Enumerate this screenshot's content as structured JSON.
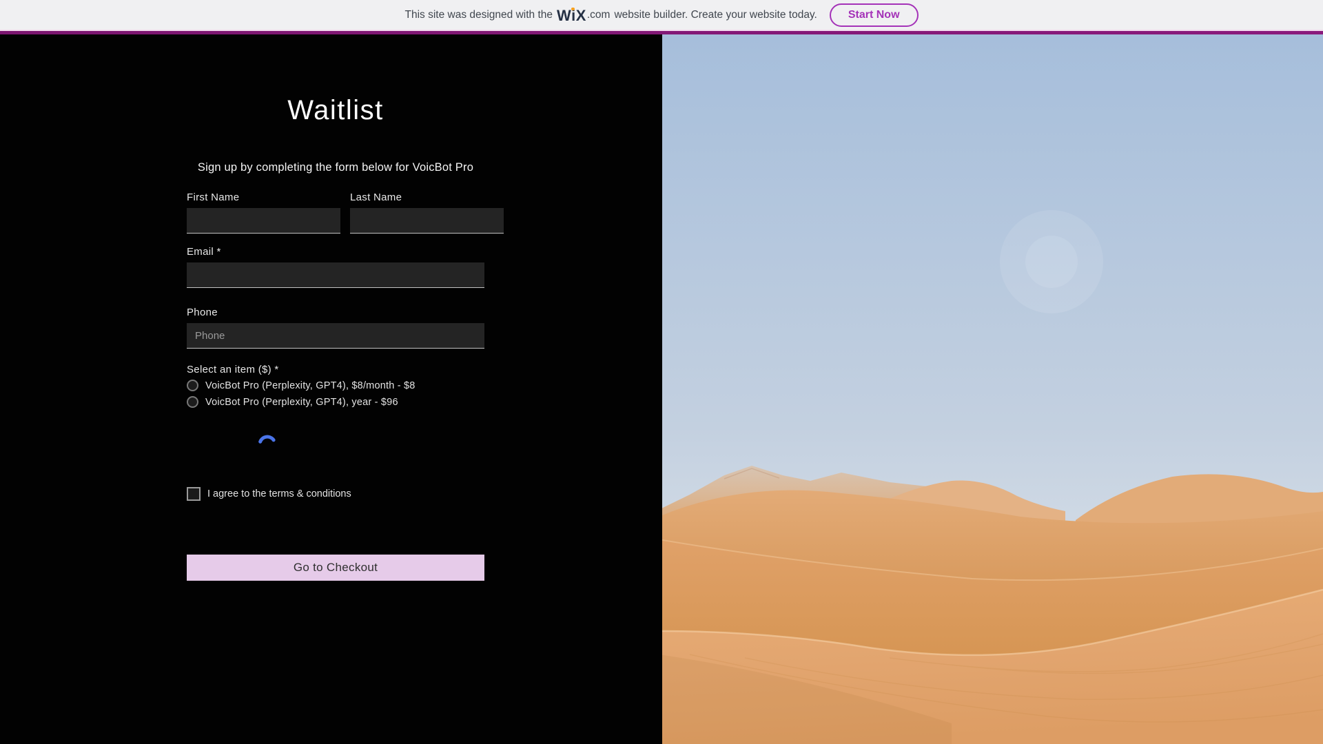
{
  "banner": {
    "message_prefix": "This site was designed with the",
    "wix_logo": "WiX",
    "wix_suffix": ".com",
    "message_mid": "website builder. Create your website today.",
    "start_button": "Start Now"
  },
  "form": {
    "title": "Waitlist",
    "subtitle": "Sign up by completing the form below for VoicBot Pro",
    "fields": {
      "first_name": {
        "label": "First Name",
        "value": "",
        "placeholder": ""
      },
      "last_name": {
        "label": "Last Name",
        "value": "",
        "placeholder": ""
      },
      "email": {
        "label": "Email *",
        "value": "",
        "placeholder": ""
      },
      "phone": {
        "label": "Phone",
        "value": "",
        "placeholder": "Phone"
      }
    },
    "select_item": {
      "label": "Select an item ($) *",
      "options": [
        {
          "label": "VoicBot Pro (Perplexity, GPT4), $8/month - $8",
          "selected": false
        },
        {
          "label": "VoicBot Pro (Perplexity, GPT4), year - $96",
          "selected": false
        }
      ]
    },
    "terms_checkbox": {
      "label": "I agree to the terms & conditions",
      "checked": false
    },
    "submit_button": "Go to Checkout",
    "status": "loading"
  },
  "colors": {
    "banner_accent": "#a432b8",
    "separator_stripe": "#7c1670",
    "submit_button_bg": "#e6cbe9",
    "spinner_blue": "#4a74e8",
    "input_bg": "#242424",
    "panel_bg": "#020202"
  }
}
